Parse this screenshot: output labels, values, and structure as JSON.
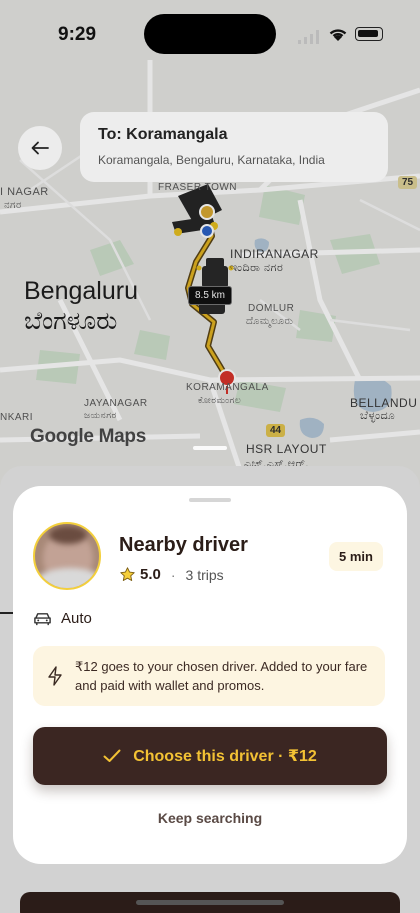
{
  "status_bar": {
    "time": "9:29"
  },
  "destination": {
    "title": "To: Koramangala",
    "address": "Koramangala, Bengaluru, Karnataka, India"
  },
  "map": {
    "city_en": "Bengaluru",
    "city_kn": "ಬೆಂಗಳೂರು",
    "distance": "8.5 km",
    "watermark": "Google Maps",
    "labels": {
      "indiranagar": "INDIRANAGAR",
      "indiranagar_kn": "ಇಂದಿರಾ ನಗರ",
      "domlur": "DOMLUR",
      "domlur_kn": "ದೊಮ್ಮಲೂರು",
      "koramangala": "KORAMANGALA",
      "koramangala_kn": "ಕೋರಮಂಗಲ",
      "jayanagar": "JAYANAGAR",
      "jayanagar_kn": "ಜಯನಗರ",
      "bellandur": "BELLANDU",
      "bellandur_kn": "ಬೆಳ್ಳಂದೂ",
      "hsr": "HSR LAYOUT",
      "hsr_kn": "ಎಚ್.ಎಸ್.ಆರ್.",
      "fraser": "FRASER TOWN",
      "inagar": "I NAGAR",
      "inagar_kn": "ನಗರ",
      "nkari": "NKARI",
      "road_44": "44",
      "road_75": "75"
    }
  },
  "driver_card": {
    "name": "Nearby driver",
    "rating": "5.0",
    "separator": "·",
    "trips": "3 trips",
    "eta": "5 min",
    "vehicle": "Auto",
    "note": "₹12 goes to your chosen driver. Added to your fare and paid with wallet and promos.",
    "choose_label": "Choose this driver · ₹12",
    "keep_label": "Keep searching"
  },
  "colors": {
    "accent": "#f3c234",
    "button_bg": "#3b2622",
    "note_bg": "#fdf5e1",
    "route": "#e2b422",
    "pin": "#d9342b"
  }
}
